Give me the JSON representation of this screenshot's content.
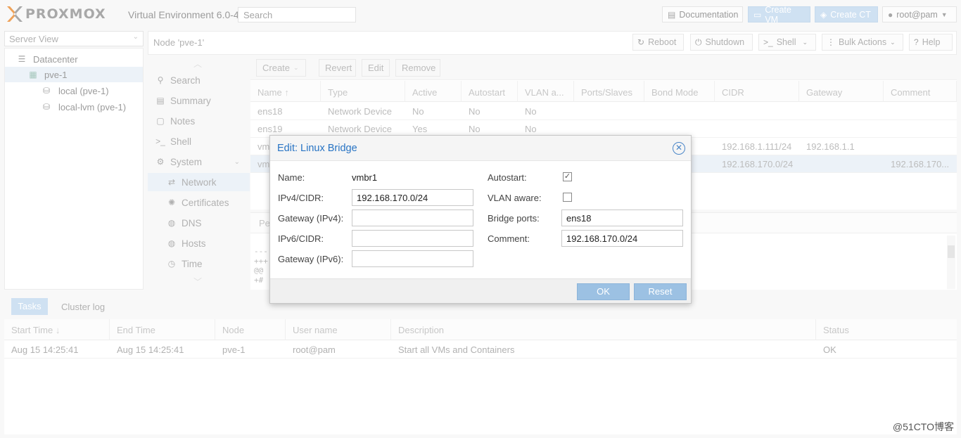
{
  "header": {
    "brand": "PROXMOX",
    "version": "Virtual Environment 6.0-4",
    "search_placeholder": "Search",
    "documentation": "Documentation",
    "create_vm": "Create VM",
    "create_ct": "Create CT",
    "user": "root@pam"
  },
  "sidebar": {
    "view": "Server View",
    "tree": [
      "Datacenter",
      "pve-1",
      "local (pve-1)",
      "local-lvm (pve-1)"
    ]
  },
  "node_header": {
    "title": "Node 'pve-1'",
    "reboot": "Reboot",
    "shutdown": "Shutdown",
    "shell": "Shell",
    "bulk": "Bulk Actions",
    "help": "Help"
  },
  "menu": [
    "Search",
    "Summary",
    "Notes",
    "Shell",
    "System",
    "Network",
    "Certificates",
    "DNS",
    "Hosts",
    "Time"
  ],
  "toolbar": {
    "create": "Create",
    "revert": "Revert",
    "edit": "Edit",
    "remove": "Remove"
  },
  "table": {
    "columns": [
      "Name",
      "Type",
      "Active",
      "Autostart",
      "VLAN a...",
      "Ports/Slaves",
      "Bond Mode",
      "CIDR",
      "Gateway",
      "Comment"
    ],
    "rows": [
      {
        "name": "ens18",
        "type": "Network Device",
        "active": "No",
        "autostart": "No",
        "vlan": "No",
        "cidr": "",
        "gateway": "",
        "comment": ""
      },
      {
        "name": "ens19",
        "type": "Network Device",
        "active": "Yes",
        "autostart": "No",
        "vlan": "No",
        "cidr": "",
        "gateway": "",
        "comment": ""
      },
      {
        "name": "vm",
        "type": "",
        "active": "",
        "autostart": "",
        "vlan": "",
        "cidr": "192.168.1.111/24",
        "gateway": "192.168.1.1",
        "comment": ""
      },
      {
        "name": "vm",
        "type": "",
        "active": "",
        "autostart": "",
        "vlan": "",
        "cidr": "192.168.170.0/24",
        "gateway": "",
        "comment": "192.168.170..."
      }
    ],
    "pending_tab": "Pe",
    "diff_lines": [
      "---",
      "+++",
      "@@",
      "+#"
    ]
  },
  "tasks": {
    "tab_tasks": "Tasks",
    "tab_cluster": "Cluster log",
    "columns": [
      "Start Time",
      "End Time",
      "Node",
      "User name",
      "Description",
      "Status"
    ],
    "row": {
      "start": "Aug 15 14:25:41",
      "end": "Aug 15 14:25:41",
      "node": "pve-1",
      "user": "root@pam",
      "desc": "Start all VMs and Containers",
      "status": "OK"
    }
  },
  "dialog": {
    "title": "Edit: Linux Bridge",
    "name_label": "Name:",
    "name_value": "vmbr1",
    "ipv4_label": "IPv4/CIDR:",
    "ipv4_value": "192.168.170.0/24",
    "gw4_label": "Gateway (IPv4):",
    "gw4_value": "",
    "ipv6_label": "IPv6/CIDR:",
    "ipv6_value": "",
    "gw6_label": "Gateway (IPv6):",
    "gw6_value": "",
    "autostart_label": "Autostart:",
    "autostart": true,
    "vlan_label": "VLAN aware:",
    "vlan": false,
    "ports_label": "Bridge ports:",
    "ports_value": "ens18",
    "comment_label": "Comment:",
    "comment_value": "192.168.170.0/24",
    "ok": "OK",
    "reset": "Reset"
  },
  "watermark": "@51CTO博客",
  "colors": {
    "accent": "#2874c4",
    "button_blue": "#9cc1e3",
    "selection": "#e2ecf5"
  }
}
